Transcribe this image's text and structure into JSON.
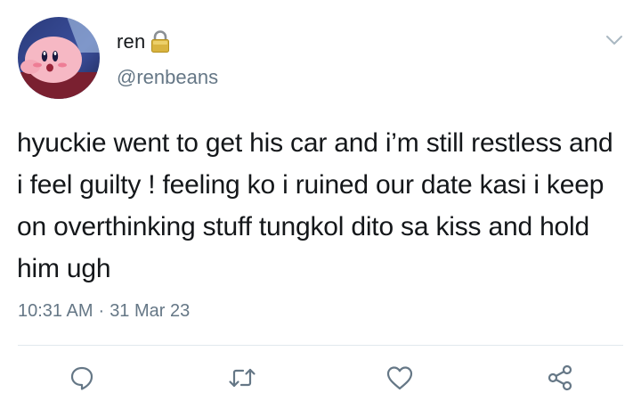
{
  "tweet": {
    "display_name": "ren",
    "handle": "@renbeans",
    "text": "hyuckie went to get his car and i’m still restless and i feel guilty ! feeling ko i ruined our date kasi i keep on overthinking stuff tungkol dito sa kiss and hold him ugh",
    "time": "10:31 AM",
    "separator": "·",
    "date": "31 Mar 23",
    "protected_account": true
  },
  "icons": {
    "avatar": "avatar-image",
    "lock": "lock-icon",
    "menu": "chevron-down-icon",
    "reply": "reply-icon",
    "retweet": "retweet-icon",
    "like": "heart-icon",
    "share": "share-icon"
  },
  "colors": {
    "text_primary": "#14171a",
    "text_secondary": "#657786",
    "icon_gray": "#657786",
    "divider": "#e1e8ed",
    "lock_gold": "#c9a227"
  }
}
